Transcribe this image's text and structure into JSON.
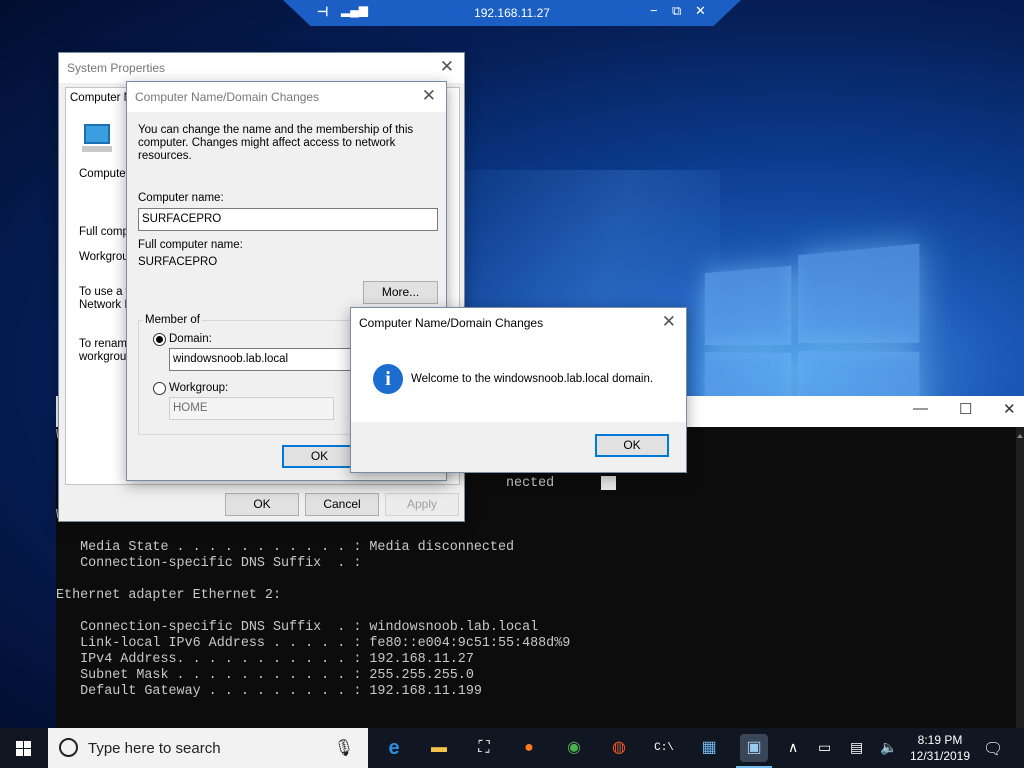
{
  "rdp_bar": {
    "title": "192.168.11.27"
  },
  "cmd": {
    "lines": [
      "W",
      "",
      "",
      "                                                        nected",
      "",
      "Wireless LAN adapter Local Area Connection* 4:",
      "",
      "   Media State . . . . . . . . . . . : Media disconnected",
      "   Connection-specific DNS Suffix  . :",
      "",
      "Ethernet adapter Ethernet 2:",
      "",
      "   Connection-specific DNS Suffix  . : windowsnoob.lab.local",
      "   Link-local IPv6 Address . . . . . : fe80::e004:9c51:55:488d%9",
      "   IPv4 Address. . . . . . . . . . . : 192.168.11.27",
      "   Subnet Mask . . . . . . . . . . . : 255.255.255.0",
      "   Default Gateway . . . . . . . . . : 192.168.11.199"
    ]
  },
  "system_properties": {
    "title": "System Properties",
    "tab_label": "Computer N",
    "computer_label": "Computer",
    "full_label": "Full compu",
    "workgroup_label": "Workgroup",
    "network_id_line1": "To use a w",
    "network_id_line2": "Network ID",
    "rename_line1": "To rename",
    "rename_line2": "workgroup",
    "ok": "OK",
    "cancel": "Cancel",
    "apply": "Apply"
  },
  "name_changes": {
    "title": "Computer Name/Domain Changes",
    "intro": "You can change the name and the membership of this computer. Changes might affect access to network resources.",
    "computer_name_label": "Computer name:",
    "computer_name_value": "SURFACEPRO",
    "full_name_label": "Full computer name:",
    "full_name_value": "SURFACEPRO",
    "more_button": "More...",
    "member_of": "Member of",
    "domain_label": "Domain:",
    "domain_value": "windowsnoob.lab.local",
    "workgroup_label": "Workgroup:",
    "workgroup_value": "HOME",
    "ok": "OK"
  },
  "welcome": {
    "title": "Computer Name/Domain Changes",
    "message": "Welcome to the windowsnoob.lab.local domain.",
    "ok": "OK"
  },
  "taskbar": {
    "search_placeholder": "Type here to search",
    "time": "8:19 PM",
    "date": "12/31/2019"
  }
}
